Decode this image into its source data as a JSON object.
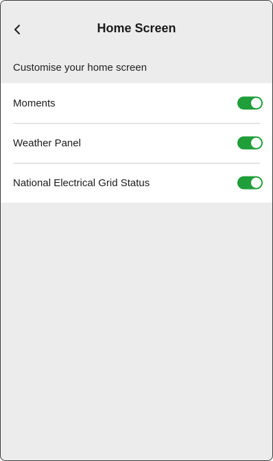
{
  "header": {
    "title": "Home Screen",
    "back_icon": "chevron-left-icon"
  },
  "subtitle": "Customise your home screen",
  "settings": [
    {
      "label": "Moments",
      "enabled": true
    },
    {
      "label": "Weather Panel",
      "enabled": true
    },
    {
      "label": "National Electrical Grid Status",
      "enabled": true
    }
  ],
  "colors": {
    "toggle_on": "#1f9e3a",
    "background": "#ececec",
    "list_background": "#ffffff"
  }
}
